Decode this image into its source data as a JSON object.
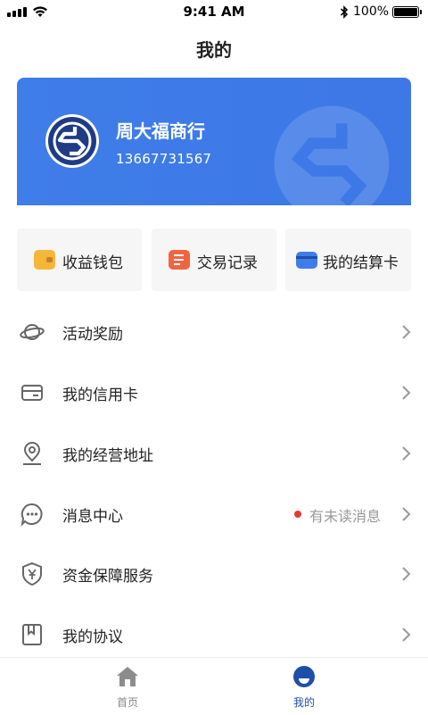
{
  "status_bar": {
    "time": "9:41 AM",
    "battery_percent": "100%"
  },
  "page": {
    "title": "我的"
  },
  "profile": {
    "shop_name": "周大福商行",
    "phone": "13667731567",
    "accent": "#3f7de9"
  },
  "quick_actions": [
    {
      "label": "收益钱包",
      "icon": "wallet-icon",
      "color": "#f5b63a"
    },
    {
      "label": "交易记录",
      "icon": "record-icon",
      "color": "#f0653f"
    },
    {
      "label": "我的结算卡",
      "icon": "card-icon",
      "color": "#3f7de9"
    }
  ],
  "menu": [
    {
      "label": "活动奖励",
      "icon": "planet-icon"
    },
    {
      "label": "我的信用卡",
      "icon": "credit-card-icon"
    },
    {
      "label": "我的经营地址",
      "icon": "location-pin-icon"
    },
    {
      "label": "消息中心",
      "icon": "message-icon",
      "badge_text": "有未读消息"
    },
    {
      "label": "资金保障服务",
      "icon": "shield-yen-icon"
    },
    {
      "label": "我的协议",
      "icon": "bookmark-doc-icon"
    }
  ],
  "tabbar": {
    "items": [
      {
        "label": "首页",
        "icon": "home-icon",
        "active": false
      },
      {
        "label": "我的",
        "icon": "profile-icon",
        "active": true
      }
    ],
    "active_color": "#1f4fa8",
    "inactive_color": "#888888"
  }
}
